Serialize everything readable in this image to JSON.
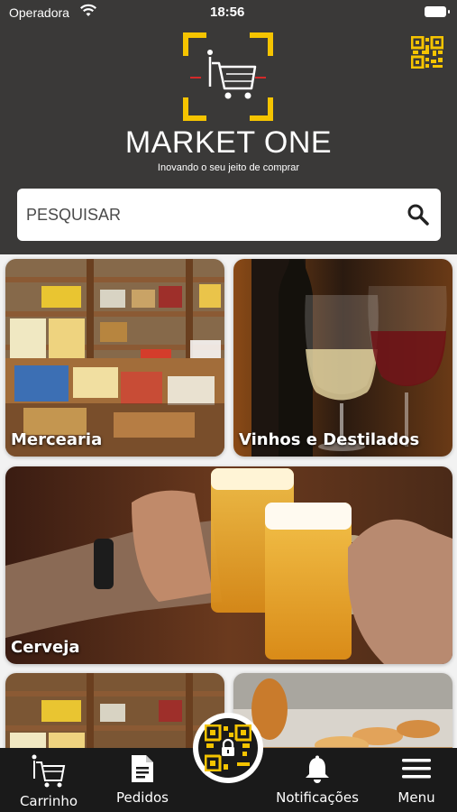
{
  "status_bar": {
    "carrier": "Operadora",
    "time": "18:56"
  },
  "brand": {
    "name": "MARKET ONE",
    "tagline": "Inovando o seu jeito de comprar",
    "accent": "#f5c400"
  },
  "search": {
    "placeholder": "PESQUISAR",
    "icon": "search-icon"
  },
  "categories": [
    {
      "label": "Mercearia"
    },
    {
      "label": "Vinhos e Destilados"
    },
    {
      "label": "Cerveja"
    },
    {
      "label": ""
    },
    {
      "label": ""
    }
  ],
  "tabbar": {
    "items": [
      {
        "label": "Carrinho",
        "icon": "cart-icon"
      },
      {
        "label": "Pedidos",
        "icon": "document-icon"
      },
      {
        "label": "",
        "icon": "qr-lock-icon"
      },
      {
        "label": "Notificações",
        "icon": "bell-icon"
      },
      {
        "label": "Menu",
        "icon": "hamburger-icon"
      }
    ]
  }
}
